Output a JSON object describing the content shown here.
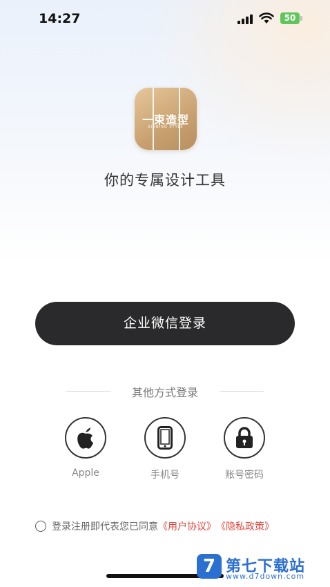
{
  "status_bar": {
    "time": "14:27",
    "battery": "50"
  },
  "logo": {
    "brand": "一束造型",
    "subtitle": "SIGNING STYLE"
  },
  "tagline": "你的专属设计工具",
  "primary_button": {
    "label": "企业微信登录"
  },
  "other_login": {
    "title": "其他方式登录",
    "options": [
      {
        "label": "Apple",
        "icon": "apple-icon"
      },
      {
        "label": "手机号",
        "icon": "phone-icon"
      },
      {
        "label": "账号密码",
        "icon": "lock-icon"
      }
    ]
  },
  "agreement": {
    "prefix": "登录注册即代表您已同意",
    "user_agreement": "《用户协议》",
    "privacy_policy": "《隐私政策》"
  },
  "watermark": {
    "mark": "7",
    "title": "第七下载站",
    "url": "www.d7down.com"
  },
  "colors": {
    "button_bg": "#2a2a2c",
    "link": "#e0493f",
    "logo_gold": "#c9a170",
    "battery_green": "#5ec65b"
  }
}
